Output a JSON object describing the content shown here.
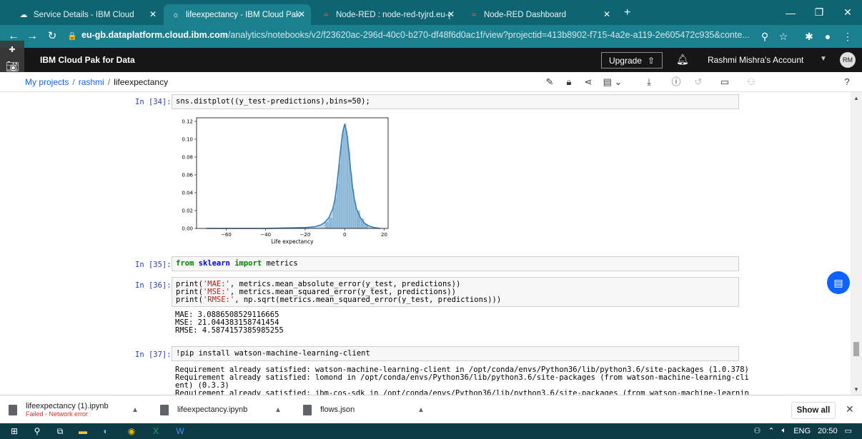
{
  "browser": {
    "tabs": [
      {
        "label": "Service Details - IBM Cloud",
        "icon": "ibm-cloud-icon"
      },
      {
        "label": "lifeexpectancy - IBM Cloud Pak fo",
        "icon": "ibm-cloud-pak-icon"
      },
      {
        "label": "Node-RED : node-red-tyjrd.eu-gb",
        "icon": "node-red-icon"
      },
      {
        "label": "Node-RED Dashboard",
        "icon": "node-red-icon"
      }
    ],
    "new_tab": "+",
    "url_host": "eu-gb.dataplatform.cloud.ibm.com",
    "url_rest": "/analytics/notebooks/v2/f23620ac-296d-40c0-b270-df48f6d0ac1f/view?projectid=413b8902-f715-4a2e-a119-2e605472c935&conte..."
  },
  "app": {
    "title": "IBM Cloud Pak for Data",
    "upgrade": "Upgrade",
    "account": "Rashmi Mishra's Account",
    "avatar": "RM"
  },
  "breadcrumb": {
    "projects": "My projects",
    "project": "rashmi",
    "notebook": "lifeexpectancy",
    "sep": "/"
  },
  "cells": [
    {
      "prompt": "In [34]:",
      "code": "sns.distplot((y_test-predictions),bins=50);"
    },
    {
      "prompt": "In [35]:",
      "code_kw1": "from",
      "code_mod": "sklearn",
      "code_kw2": "import",
      "code_rest": "metrics"
    },
    {
      "prompt": "In [36]:",
      "lines": [
        {
          "fn": "print(",
          "s": "'MAE:'",
          "rest": ", metrics.mean_absolute_error(y_test, predictions))"
        },
        {
          "fn": "print(",
          "s": "'MSE:'",
          "rest": ", metrics.mean_squared_error(y_test, predictions))"
        },
        {
          "fn": "print(",
          "s": "'RMSE:'",
          "rest": ", np.sqrt(metrics.mean_squared_error(y_test, predictions)))"
        }
      ],
      "output": [
        "MAE: 3.0886508529116665",
        "MSE: 21.044383158741454",
        "RMSE: 4.5874157385985255"
      ]
    },
    {
      "prompt": "In [37]:",
      "code": "!pip install watson-machine-learning-client",
      "output": [
        "Requirement already satisfied: watson-machine-learning-client in /opt/conda/envs/Python36/lib/python3.6/site-packages (1.0.378)",
        "Requirement already satisfied: lomond in /opt/conda/envs/Python36/lib/python3.6/site-packages (from watson-machine-learning-cli",
        "ent) (0.3.3)",
        "Requirement already satisfied: ibm-cos-sdk in /opt/conda/envs/Python36/lib/python3.6/site-packages (from watson-machine-learnin"
      ]
    }
  ],
  "chart_data": {
    "type": "area",
    "xlabel": "Life expectancy",
    "ylabel": "",
    "xlim": [
      -75,
      22
    ],
    "ylim": [
      0,
      0.124
    ],
    "xticks": [
      -60,
      -40,
      -20,
      0,
      20
    ],
    "yticks": [
      0.0,
      0.02,
      0.04,
      0.06,
      0.08,
      0.1,
      0.12
    ],
    "ytick_labels": [
      "0.00",
      "0.02",
      "0.04",
      "0.06",
      "0.08",
      "0.10",
      "0.12"
    ],
    "color": "#4c8fc0",
    "kde": {
      "x": [
        -70,
        -40,
        -30,
        -20,
        -15,
        -12,
        -10,
        -8,
        -6,
        -5,
        -4,
        -3,
        -2,
        -1,
        0,
        1,
        2,
        3,
        4,
        5,
        6,
        8,
        10,
        12,
        15,
        18
      ],
      "y": [
        0,
        0,
        0.0005,
        0.001,
        0.002,
        0.004,
        0.007,
        0.012,
        0.022,
        0.032,
        0.048,
        0.068,
        0.09,
        0.108,
        0.117,
        0.108,
        0.09,
        0.066,
        0.046,
        0.032,
        0.022,
        0.012,
        0.006,
        0.003,
        0.001,
        0
      ]
    },
    "hist": {
      "bin_left": [
        -10,
        -8,
        -6,
        -5,
        -4,
        -3,
        -2,
        -1,
        0,
        1,
        2,
        3,
        4,
        5,
        6,
        8,
        10
      ],
      "bin_width": [
        2,
        2,
        1,
        1,
        1,
        1,
        1,
        1,
        1,
        1,
        1,
        1,
        1,
        1,
        2,
        2,
        2
      ],
      "height": [
        0.007,
        0.012,
        0.024,
        0.034,
        0.05,
        0.072,
        0.094,
        0.112,
        0.118,
        0.104,
        0.086,
        0.062,
        0.044,
        0.03,
        0.02,
        0.011,
        0.005
      ]
    }
  },
  "downloads": [
    {
      "name": "lifeexpectancy (1).ipynb",
      "status": "Failed - Network error"
    },
    {
      "name": "lifeexpectancy.ipynb",
      "status": ""
    },
    {
      "name": "flows.json",
      "status": ""
    }
  ],
  "show_all": "Show all",
  "taskbar": {
    "lang": "ENG",
    "time": "20:50"
  }
}
